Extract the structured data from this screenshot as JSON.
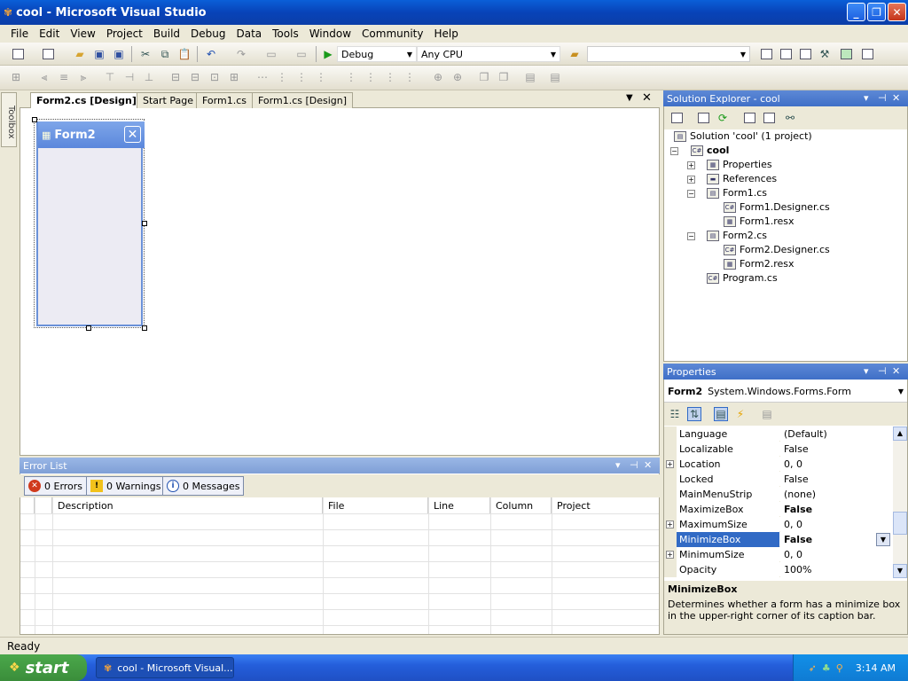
{
  "window": {
    "title": "cool - Microsoft Visual Studio"
  },
  "menu": [
    "File",
    "Edit",
    "View",
    "Project",
    "Build",
    "Debug",
    "Data",
    "Tools",
    "Window",
    "Community",
    "Help"
  ],
  "toolbar": {
    "config": "Debug",
    "platform": "Any CPU",
    "find": ""
  },
  "toolbox_label": "Toolbox",
  "doc_tabs": [
    "Form2.cs [Design]*",
    "Start Page",
    "Form1.cs",
    "Form1.cs [Design]"
  ],
  "designer": {
    "form_title": "Form2"
  },
  "error_list": {
    "title": "Error List",
    "errors": "0 Errors",
    "warnings": "0 Warnings",
    "messages": "0 Messages",
    "columns": [
      "Description",
      "File",
      "Line",
      "Column",
      "Project"
    ]
  },
  "solution_explorer": {
    "title": "Solution Explorer - cool",
    "items": [
      {
        "label": "Solution 'cool' (1 project)"
      },
      {
        "label": "cool"
      },
      {
        "label": "Properties"
      },
      {
        "label": "References"
      },
      {
        "label": "Form1.cs"
      },
      {
        "label": "Form1.Designer.cs"
      },
      {
        "label": "Form1.resx"
      },
      {
        "label": "Form2.cs"
      },
      {
        "label": "Form2.Designer.cs"
      },
      {
        "label": "Form2.resx"
      },
      {
        "label": "Program.cs"
      }
    ]
  },
  "properties": {
    "title": "Properties",
    "object_name": "Form2",
    "object_type": "System.Windows.Forms.Form",
    "rows": [
      {
        "name": "Language",
        "value": "(Default)"
      },
      {
        "name": "Localizable",
        "value": "False"
      },
      {
        "name": "Location",
        "value": "0, 0"
      },
      {
        "name": "Locked",
        "value": "False"
      },
      {
        "name": "MainMenuStrip",
        "value": "(none)"
      },
      {
        "name": "MaximizeBox",
        "value": "False"
      },
      {
        "name": "MaximumSize",
        "value": "0, 0"
      },
      {
        "name": "MinimizeBox",
        "value": "False"
      },
      {
        "name": "MinimumSize",
        "value": "0, 0"
      },
      {
        "name": "Opacity",
        "value": "100%"
      }
    ],
    "desc_title": "MinimizeBox",
    "desc_text": "Determines whether a form has a minimize box in the upper-right corner of its caption bar."
  },
  "status": "Ready",
  "taskbar": {
    "start": "start",
    "item": "cool - Microsoft Visual...",
    "clock": "3:14 AM"
  }
}
